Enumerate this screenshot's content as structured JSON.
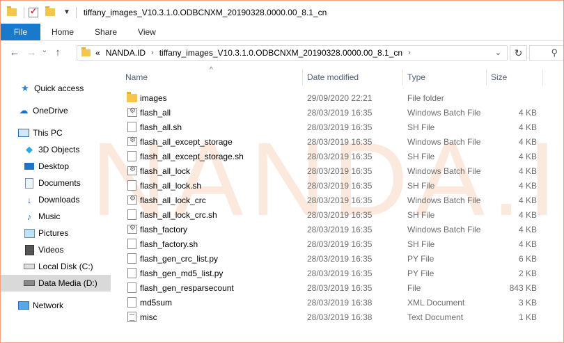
{
  "window": {
    "title": "tiffany_images_V10.3.1.0.ODBCNXM_20190328.0000.00_8.1_cn"
  },
  "ribbon": {
    "file_label": "File",
    "tabs": [
      "Home",
      "Share",
      "View"
    ]
  },
  "address": {
    "overflow": "«",
    "segments": [
      "NANDA.ID",
      "tiffany_images_V10.3.1.0.ODBCNXM_20190328.0000.00_8.1_cn"
    ]
  },
  "sidebar": {
    "items": [
      {
        "label": "Quick access",
        "icon": "star-icon"
      },
      {
        "label": "OneDrive",
        "icon": "cloud-icon"
      },
      {
        "label": "This PC",
        "icon": "computer-icon"
      },
      {
        "label": "3D Objects",
        "icon": "cube-icon"
      },
      {
        "label": "Desktop",
        "icon": "desktop-icon"
      },
      {
        "label": "Documents",
        "icon": "document-icon"
      },
      {
        "label": "Downloads",
        "icon": "download-icon"
      },
      {
        "label": "Music",
        "icon": "music-icon"
      },
      {
        "label": "Pictures",
        "icon": "pictures-icon"
      },
      {
        "label": "Videos",
        "icon": "video-icon"
      },
      {
        "label": "Local Disk (C:)",
        "icon": "drive-icon"
      },
      {
        "label": "Data Media (D:)",
        "icon": "drive-icon"
      },
      {
        "label": "Network",
        "icon": "network-icon"
      }
    ],
    "selected": "Data Media (D:)"
  },
  "columns": {
    "name": "Name",
    "date": "Date modified",
    "type": "Type",
    "size": "Size"
  },
  "files": [
    {
      "name": "images",
      "date": "29/09/2020 22:21",
      "type": "File folder",
      "size": "",
      "icon": "folder"
    },
    {
      "name": "flash_all",
      "date": "28/03/2019 16:35",
      "type": "Windows Batch File",
      "size": "4 KB",
      "icon": "batch"
    },
    {
      "name": "flash_all.sh",
      "date": "28/03/2019 16:35",
      "type": "SH File",
      "size": "4 KB",
      "icon": "doc"
    },
    {
      "name": "flash_all_except_storage",
      "date": "28/03/2019 16:35",
      "type": "Windows Batch File",
      "size": "4 KB",
      "icon": "batch"
    },
    {
      "name": "flash_all_except_storage.sh",
      "date": "28/03/2019 16:35",
      "type": "SH File",
      "size": "4 KB",
      "icon": "doc"
    },
    {
      "name": "flash_all_lock",
      "date": "28/03/2019 16:35",
      "type": "Windows Batch File",
      "size": "4 KB",
      "icon": "batch"
    },
    {
      "name": "flash_all_lock.sh",
      "date": "28/03/2019 16:35",
      "type": "SH File",
      "size": "4 KB",
      "icon": "doc"
    },
    {
      "name": "flash_all_lock_crc",
      "date": "28/03/2019 16:35",
      "type": "Windows Batch File",
      "size": "4 KB",
      "icon": "batch"
    },
    {
      "name": "flash_all_lock_crc.sh",
      "date": "28/03/2019 16:35",
      "type": "SH File",
      "size": "4 KB",
      "icon": "doc"
    },
    {
      "name": "flash_factory",
      "date": "28/03/2019 16:35",
      "type": "Windows Batch File",
      "size": "4 KB",
      "icon": "batch"
    },
    {
      "name": "flash_factory.sh",
      "date": "28/03/2019 16:35",
      "type": "SH File",
      "size": "4 KB",
      "icon": "doc"
    },
    {
      "name": "flash_gen_crc_list.py",
      "date": "28/03/2019 16:35",
      "type": "PY File",
      "size": "6 KB",
      "icon": "doc"
    },
    {
      "name": "flash_gen_md5_list.py",
      "date": "28/03/2019 16:35",
      "type": "PY File",
      "size": "2 KB",
      "icon": "doc"
    },
    {
      "name": "flash_gen_resparsecount",
      "date": "28/03/2019 16:35",
      "type": "File",
      "size": "843 KB",
      "icon": "doc"
    },
    {
      "name": "md5sum",
      "date": "28/03/2019 16:38",
      "type": "XML Document",
      "size": "3 KB",
      "icon": "doc"
    },
    {
      "name": "misc",
      "date": "28/03/2019 16:38",
      "type": "Text Document",
      "size": "1 KB",
      "icon": "text"
    }
  ],
  "watermark": "NANDA.ID"
}
